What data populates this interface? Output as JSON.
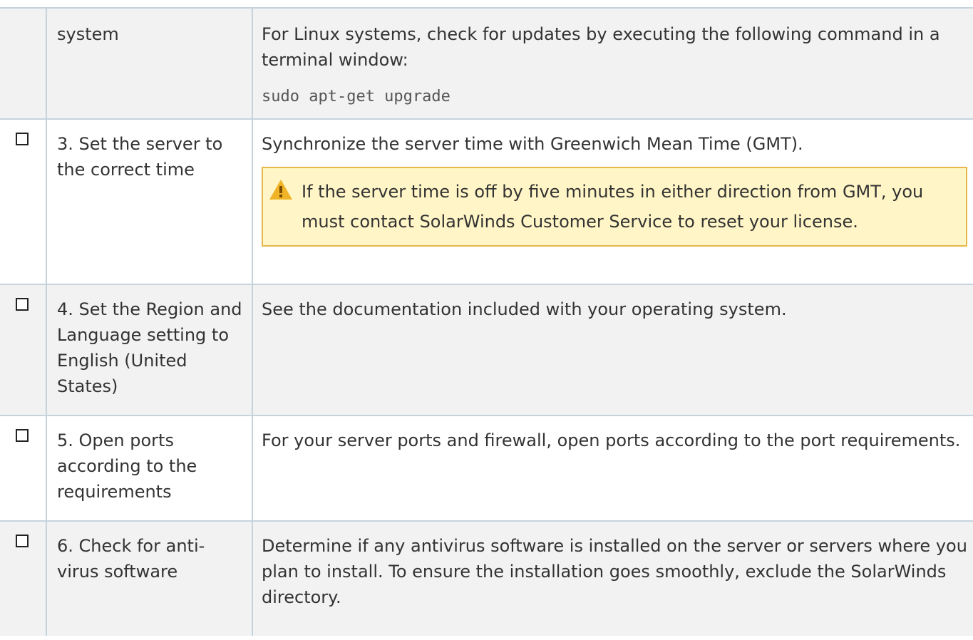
{
  "rows": [
    {
      "has_checkbox": false,
      "step": "system",
      "desc": [
        "For Linux systems, check for updates by executing the following command in a terminal window:"
      ],
      "code": "sudo apt-get upgrade"
    },
    {
      "has_checkbox": true,
      "step": "3. Set the server to the correct time",
      "desc": [
        "Synchronize the server time with Greenwich Mean Time (GMT)."
      ],
      "note": "If the server time is off by five minutes in either direction from GMT, you must contact SolarWinds Customer Service to reset your license."
    },
    {
      "has_checkbox": true,
      "step": "4. Set the Region and Language setting to English (United States)",
      "desc": [
        "See the documentation included with your operating system."
      ]
    },
    {
      "has_checkbox": true,
      "step": "5. Open ports according to the requirements",
      "desc": [
        "For your server ports and firewall, open ports according to the port requirements."
      ]
    },
    {
      "has_checkbox": true,
      "step": "6. Check for anti-virus software",
      "desc": [
        "Determine if any antivirus software is installed on the server or servers where you plan to install. To ensure the installation goes smoothly, exclude the SolarWinds directory."
      ]
    }
  ]
}
